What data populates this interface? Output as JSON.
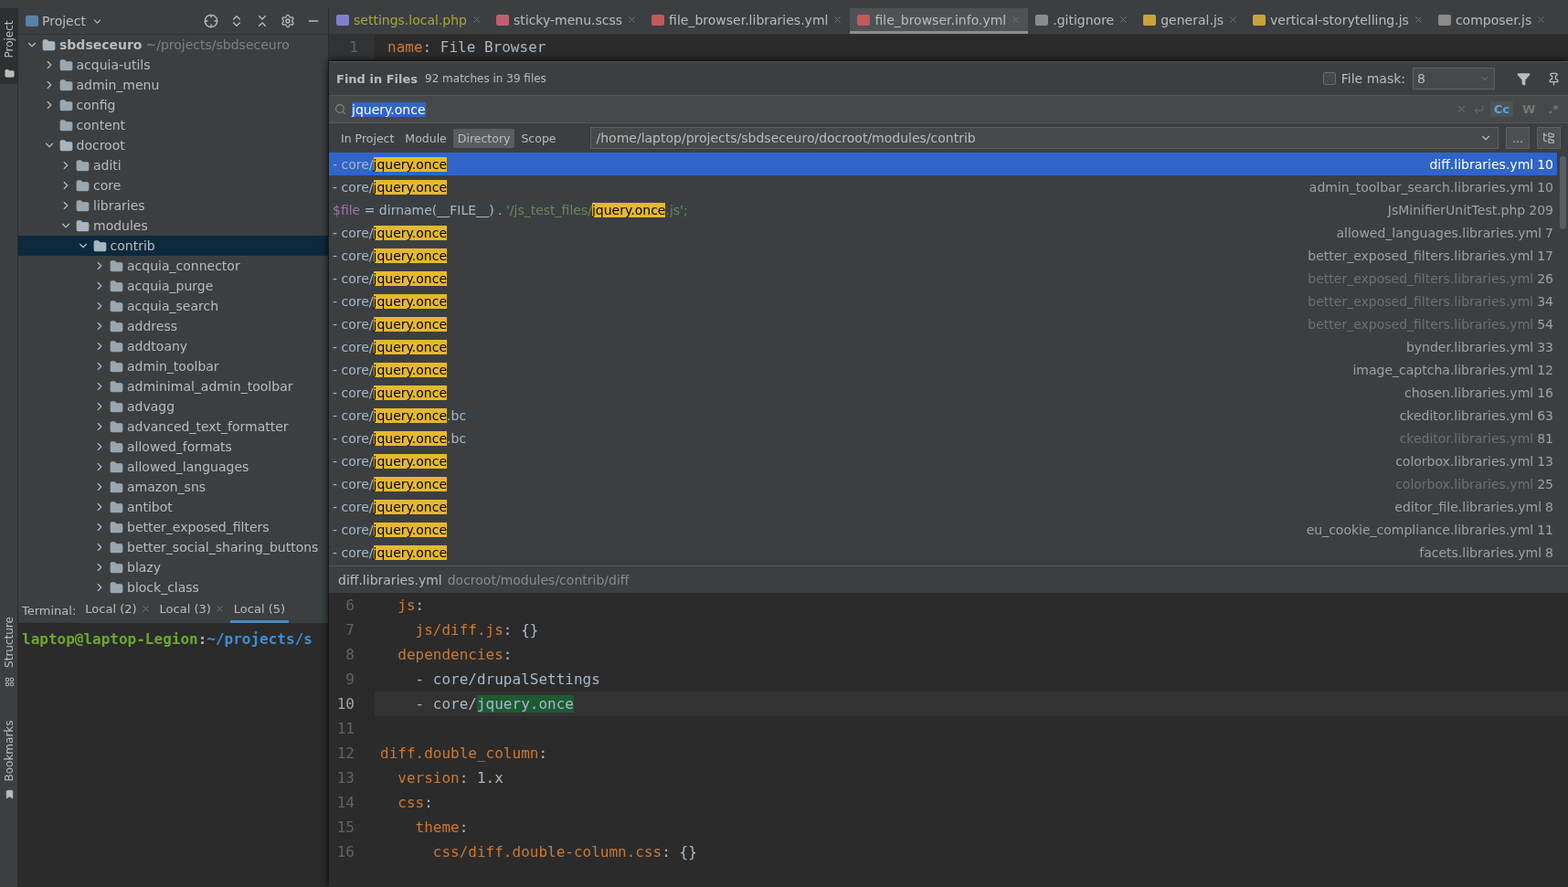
{
  "side_strip": {
    "top": [
      {
        "label": "Project",
        "selected": true
      }
    ],
    "bottom": [
      {
        "label": "Structure",
        "selected": false
      },
      {
        "label": "Bookmarks",
        "selected": false
      }
    ]
  },
  "project_panel": {
    "title": "Project",
    "tree": [
      {
        "name": "sbdseceuro",
        "hint": "~/projects/sbdseceuro",
        "expandable": true,
        "expanded": true,
        "selected": false,
        "children": [
          {
            "name": "acquia-utils",
            "expandable": true,
            "expanded": false,
            "selected": false
          },
          {
            "name": "admin_menu",
            "expandable": true,
            "expanded": false,
            "selected": false
          },
          {
            "name": "config",
            "expandable": true,
            "expanded": false,
            "selected": false
          },
          {
            "name": "content",
            "expandable": false,
            "expanded": false,
            "selected": false
          },
          {
            "name": "docroot",
            "expandable": true,
            "expanded": true,
            "selected": false,
            "children": [
              {
                "name": "aditi",
                "expandable": true,
                "expanded": false,
                "selected": false
              },
              {
                "name": "core",
                "expandable": true,
                "expanded": false,
                "selected": false
              },
              {
                "name": "libraries",
                "expandable": true,
                "expanded": false,
                "selected": false
              },
              {
                "name": "modules",
                "expandable": true,
                "expanded": true,
                "selected": false,
                "children": [
                  {
                    "name": "contrib",
                    "expandable": true,
                    "expanded": true,
                    "selected": true,
                    "children": [
                      {
                        "name": "acquia_connector",
                        "expandable": true,
                        "expanded": false,
                        "selected": false
                      },
                      {
                        "name": "acquia_purge",
                        "expandable": true,
                        "expanded": false,
                        "selected": false
                      },
                      {
                        "name": "acquia_search",
                        "expandable": true,
                        "expanded": false,
                        "selected": false
                      },
                      {
                        "name": "address",
                        "expandable": true,
                        "expanded": false,
                        "selected": false
                      },
                      {
                        "name": "addtoany",
                        "expandable": true,
                        "expanded": false,
                        "selected": false
                      },
                      {
                        "name": "admin_toolbar",
                        "expandable": true,
                        "expanded": false,
                        "selected": false
                      },
                      {
                        "name": "adminimal_admin_toolbar",
                        "expandable": true,
                        "expanded": false,
                        "selected": false
                      },
                      {
                        "name": "advagg",
                        "expandable": true,
                        "expanded": false,
                        "selected": false
                      },
                      {
                        "name": "advanced_text_formatter",
                        "expandable": true,
                        "expanded": false,
                        "selected": false
                      },
                      {
                        "name": "allowed_formats",
                        "expandable": true,
                        "expanded": false,
                        "selected": false
                      },
                      {
                        "name": "allowed_languages",
                        "expandable": true,
                        "expanded": false,
                        "selected": false
                      },
                      {
                        "name": "amazon_sns",
                        "expandable": true,
                        "expanded": false,
                        "selected": false
                      },
                      {
                        "name": "antibot",
                        "expandable": true,
                        "expanded": false,
                        "selected": false
                      },
                      {
                        "name": "better_exposed_filters",
                        "expandable": true,
                        "expanded": false,
                        "selected": false
                      },
                      {
                        "name": "better_social_sharing_buttons",
                        "expandable": true,
                        "expanded": false,
                        "selected": false
                      },
                      {
                        "name": "blazy",
                        "expandable": true,
                        "expanded": false,
                        "selected": false
                      },
                      {
                        "name": "block_class",
                        "expandable": true,
                        "expanded": false,
                        "selected": false
                      }
                    ]
                  }
                ]
              }
            ]
          }
        ]
      }
    ]
  },
  "terminal": {
    "label": "Terminal:",
    "tabs": [
      {
        "label": "Local (2)",
        "selected": false
      },
      {
        "label": "Local (3)",
        "selected": false
      },
      {
        "label": "Local (5)",
        "selected": true
      }
    ],
    "user": "laptop@laptop-Legion",
    "separator": ":",
    "path": "~/projects/s"
  },
  "editor_tabs": [
    {
      "label": "settings.local.php",
      "color": "#7f7fcc",
      "modified": true,
      "selected": false
    },
    {
      "label": "sticky-menu.scss",
      "color": "#c06070",
      "modified": false,
      "selected": false
    },
    {
      "label": "file_browser.libraries.yml",
      "color": "#c25a5a",
      "modified": false,
      "selected": false
    },
    {
      "label": "file_browser.info.yml",
      "color": "#c25a5a",
      "modified": false,
      "selected": true
    },
    {
      "label": ".gitignore",
      "color": "#8a8a8a",
      "modified": false,
      "selected": false
    },
    {
      "label": "general.js",
      "color": "#c9a43a",
      "modified": false,
      "selected": false
    },
    {
      "label": "vertical-storytelling.js",
      "color": "#c9a43b",
      "modified": false,
      "selected": false
    },
    {
      "label": "composer.js",
      "color": "#8a8a8b",
      "modified": false,
      "selected": false
    }
  ],
  "editor": {
    "lines": [
      {
        "number": "1",
        "tokens": [
          {
            "text": "name",
            "kind": "key"
          },
          {
            "text": ": File Browser",
            "kind": "plain"
          }
        ]
      }
    ]
  },
  "find_popup": {
    "title": "Find in Files",
    "summary": "92 matches in 39 files",
    "file_mask": {
      "label": "File mask:",
      "checked": false,
      "value": "8"
    },
    "query": "jquery.once",
    "toggles": [
      {
        "label": "Cc",
        "on": true
      },
      {
        "label": "W",
        "on": false
      },
      {
        "label": ".*",
        "on": false
      }
    ],
    "scopes": [
      {
        "label": "In Project",
        "selected": false
      },
      {
        "label": "Module",
        "selected": false
      },
      {
        "label": "Directory",
        "selected": true
      },
      {
        "label": "Scope",
        "selected": false
      }
    ],
    "directory": "/home/laptop/projects/sbdseceuro/docroot/modules/contrib",
    "browse_button": "...",
    "results": [
      {
        "before": [
          {
            "text": "- core/",
            "kind": "plain"
          }
        ],
        "match": "jquery.once",
        "file": "diff.libraries.yml",
        "line": "10",
        "selected": true,
        "dimmed": false
      },
      {
        "before": [
          {
            "text": "- core/",
            "kind": "plain"
          }
        ],
        "match": "jquery.once",
        "file": "admin_toolbar_search.libraries.yml",
        "line": "10",
        "selected": false,
        "dimmed": false
      },
      {
        "before": [
          {
            "text": "$file",
            "kind": "variable"
          },
          {
            "text": " = dirname(__FILE__) . ",
            "kind": "plain"
          },
          {
            "text": "'/js_test_files/",
            "kind": "string"
          }
        ],
        "match": "jquery.once",
        "after": [
          {
            "text": ".js';",
            "kind": "string"
          }
        ],
        "file": "JsMinifierUnitTest.php",
        "line": "209",
        "selected": false,
        "dimmed": false
      },
      {
        "before": [
          {
            "text": "- core/",
            "kind": "plain"
          }
        ],
        "match": "jquery.once",
        "file": "allowed_languages.libraries.yml",
        "line": "7",
        "selected": false,
        "dimmed": false
      },
      {
        "before": [
          {
            "text": "- core/",
            "kind": "plain"
          }
        ],
        "match": "jquery.once",
        "file": "better_exposed_filters.libraries.yml",
        "line": "17",
        "selected": false,
        "dimmed": false
      },
      {
        "before": [
          {
            "text": "- core/",
            "kind": "plain"
          }
        ],
        "match": "jquery.once",
        "file": "better_exposed_filters.libraries.yml",
        "line": "26",
        "selected": false,
        "dimmed": true
      },
      {
        "before": [
          {
            "text": "- core/",
            "kind": "plain"
          }
        ],
        "match": "jquery.once",
        "file": "better_exposed_filters.libraries.yml",
        "line": "34",
        "selected": false,
        "dimmed": true
      },
      {
        "before": [
          {
            "text": "- core/",
            "kind": "plain"
          }
        ],
        "match": "jquery.once",
        "file": "better_exposed_filters.libraries.yml",
        "line": "54",
        "selected": false,
        "dimmed": true
      },
      {
        "before": [
          {
            "text": "- core/",
            "kind": "plain"
          }
        ],
        "match": "jquery.once",
        "file": "bynder.libraries.yml",
        "line": "33",
        "selected": false,
        "dimmed": false
      },
      {
        "before": [
          {
            "text": "- core/",
            "kind": "plain"
          }
        ],
        "match": "jquery.once",
        "file": "image_captcha.libraries.yml",
        "line": "12",
        "selected": false,
        "dimmed": false
      },
      {
        "before": [
          {
            "text": "- core/",
            "kind": "plain"
          }
        ],
        "match": "jquery.once",
        "file": "chosen.libraries.yml",
        "line": "16",
        "selected": false,
        "dimmed": false
      },
      {
        "before": [
          {
            "text": "- core/",
            "kind": "plain"
          }
        ],
        "match": "jquery.once",
        "after": [
          {
            "text": ".bc",
            "kind": "plain"
          }
        ],
        "file": "ckeditor.libraries.yml",
        "line": "63",
        "selected": false,
        "dimmed": false
      },
      {
        "before": [
          {
            "text": "- core/",
            "kind": "plain"
          }
        ],
        "match": "jquery.once",
        "after": [
          {
            "text": ".bc",
            "kind": "plain"
          }
        ],
        "file": "ckeditor.libraries.yml",
        "line": "81",
        "selected": false,
        "dimmed": true
      },
      {
        "before": [
          {
            "text": "- core/",
            "kind": "plain"
          }
        ],
        "match": "jquery.once",
        "file": "colorbox.libraries.yml",
        "line": "13",
        "selected": false,
        "dimmed": false
      },
      {
        "before": [
          {
            "text": "- core/",
            "kind": "plain"
          }
        ],
        "match": "jquery.once",
        "file": "colorbox.libraries.yml",
        "line": "25",
        "selected": false,
        "dimmed": true
      },
      {
        "before": [
          {
            "text": "- core/",
            "kind": "plain"
          }
        ],
        "match": "jquery.once",
        "file": "editor_file.libraries.yml",
        "line": "8",
        "selected": false,
        "dimmed": false
      },
      {
        "before": [
          {
            "text": "- core/",
            "kind": "plain"
          }
        ],
        "match": "jquery.once",
        "file": "eu_cookie_compliance.libraries.yml",
        "line": "11",
        "selected": false,
        "dimmed": false
      },
      {
        "before": [
          {
            "text": "- core/",
            "kind": "plain"
          }
        ],
        "match": "jquery.once",
        "file": "facets.libraries.yml",
        "line": "8",
        "selected": false,
        "dimmed": false
      }
    ],
    "preview": {
      "file": "diff.libraries.yml",
      "path": "docroot/modules/contrib/diff",
      "lines": [
        {
          "number": "6",
          "current": false,
          "tokens": [
            {
              "text": "  js",
              "kind": "key"
            },
            {
              "text": ":",
              "kind": "plain"
            }
          ]
        },
        {
          "number": "7",
          "current": false,
          "tokens": [
            {
              "text": "    js/diff.js",
              "kind": "key"
            },
            {
              "text": ": {}",
              "kind": "plain"
            }
          ]
        },
        {
          "number": "8",
          "current": false,
          "tokens": [
            {
              "text": "  dependencies",
              "kind": "key"
            },
            {
              "text": ":",
              "kind": "plain"
            }
          ]
        },
        {
          "number": "9",
          "current": false,
          "tokens": [
            {
              "text": "    - core/drupalSettings",
              "kind": "plain"
            }
          ]
        },
        {
          "number": "10",
          "current": true,
          "tokens": [
            {
              "text": "    - core/",
              "kind": "plain"
            },
            {
              "text": "jquery.once",
              "kind": "match"
            }
          ]
        },
        {
          "number": "11",
          "current": false
        },
        {
          "number": "12",
          "current": false,
          "tokens": [
            {
              "text": "diff.double_column",
              "kind": "key"
            },
            {
              "text": ":",
              "kind": "plain"
            }
          ]
        },
        {
          "number": "13",
          "current": false,
          "tokens": [
            {
              "text": "  version",
              "kind": "key"
            },
            {
              "text": ": 1.x",
              "kind": "plain"
            }
          ]
        },
        {
          "number": "14",
          "current": false,
          "tokens": [
            {
              "text": "  css",
              "kind": "key"
            },
            {
              "text": ":",
              "kind": "plain"
            }
          ]
        },
        {
          "number": "15",
          "current": false,
          "tokens": [
            {
              "text": "    theme",
              "kind": "key"
            },
            {
              "text": ":",
              "kind": "plain"
            }
          ]
        },
        {
          "number": "16",
          "current": false,
          "tokens": [
            {
              "text": "      css/diff.double-column.css",
              "kind": "key"
            },
            {
              "text": ": {}",
              "kind": "plain"
            }
          ]
        }
      ]
    }
  }
}
